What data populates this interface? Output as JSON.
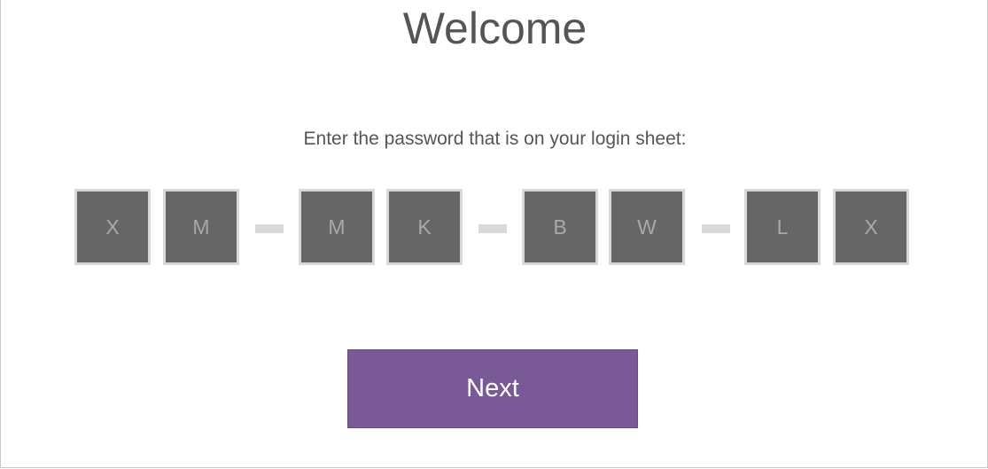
{
  "page": {
    "title": "Welcome",
    "instruction": "Enter the password that is on your login sheet:"
  },
  "password": {
    "characters": [
      "X",
      "M",
      "M",
      "K",
      "B",
      "W",
      "L",
      "X"
    ]
  },
  "actions": {
    "next_label": "Next"
  },
  "colors": {
    "box_fill": "#666666",
    "box_border": "#d9d9d9",
    "dash": "#dadada",
    "button": "#7a5a96",
    "text": "#555555"
  }
}
